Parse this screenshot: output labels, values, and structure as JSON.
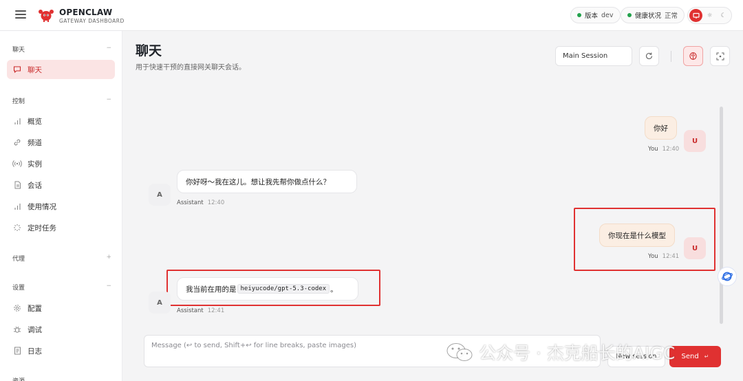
{
  "brand": {
    "title": "OPENCLAW",
    "subtitle": "GATEWAY DASHBOARD"
  },
  "header": {
    "version_label": "版本",
    "version_value": "dev",
    "health_label": "健康状况",
    "health_value": "正常",
    "status_color": "#22a14b",
    "accent_color": "#e03131"
  },
  "sidebar": {
    "sections": [
      {
        "title": "聊天",
        "toggle": "−",
        "items": [
          {
            "label": "聊天",
            "icon": "chat-icon",
            "active": true
          }
        ]
      },
      {
        "title": "控制",
        "toggle": "−",
        "items": [
          {
            "label": "概览",
            "icon": "bar-chart-icon"
          },
          {
            "label": "频道",
            "icon": "link-icon"
          },
          {
            "label": "实例",
            "icon": "broadcast-icon"
          },
          {
            "label": "会话",
            "icon": "document-icon"
          },
          {
            "label": "使用情况",
            "icon": "bar-chart-icon"
          },
          {
            "label": "定时任务",
            "icon": "spinner-icon"
          }
        ]
      },
      {
        "title": "代理",
        "toggle": "+",
        "items": []
      },
      {
        "title": "设置",
        "toggle": "−",
        "items": [
          {
            "label": "配置",
            "icon": "gear-icon"
          },
          {
            "label": "调试",
            "icon": "bug-icon"
          },
          {
            "label": "日志",
            "icon": "log-icon"
          }
        ]
      },
      {
        "title": "资源",
        "toggle": "",
        "items": []
      }
    ]
  },
  "main": {
    "title": "聊天",
    "subtitle": "用于快速干预的直接网关聊天会话。",
    "session_name": "Main Session"
  },
  "messages": [
    {
      "role": "user",
      "text": "你好",
      "sender": "You",
      "time": "12:40",
      "avatar": "U"
    },
    {
      "role": "assistant",
      "text": "你好呀～我在这儿。想让我先帮你做点什么？",
      "sender": "Assistant",
      "time": "12:40",
      "avatar": "A"
    },
    {
      "role": "user",
      "text": "你现在是什么模型",
      "sender": "You",
      "time": "12:41",
      "avatar": "U"
    },
    {
      "role": "assistant",
      "text_before": "我当前在用的是",
      "code": "heiyucode/gpt-5.3-codex",
      "text_after": "。",
      "sender": "Assistant",
      "time": "12:41",
      "avatar": "A"
    }
  ],
  "composer": {
    "placeholder": "Message (↩ to send, Shift+↩ for line breaks, paste images)",
    "new_session_label": "New session",
    "send_label": "Send",
    "send_shortcut": "↵"
  },
  "watermark": {
    "text": "公众号 · 杰克船长的AIGC"
  }
}
